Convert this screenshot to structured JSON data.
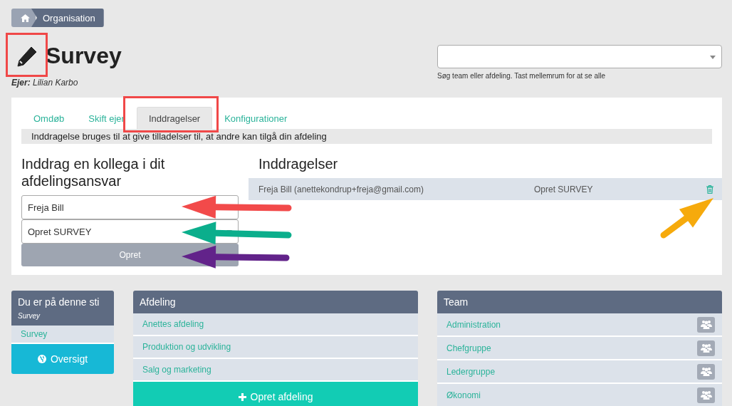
{
  "breadcrumb": [
    {
      "kind": "home"
    },
    {
      "kind": "link",
      "label": "Organisation"
    }
  ],
  "page": {
    "title": "Survey",
    "owner_label": "Ejer:",
    "owner": "Lilian Karbo"
  },
  "search": {
    "hint": "Søg team eller afdeling. Tast mellemrum for at se alle"
  },
  "tabs": [
    {
      "label": "Omdøb",
      "selected": false
    },
    {
      "label": "Skift ejer",
      "selected": false
    },
    {
      "label": "Inddragelser",
      "selected": true
    },
    {
      "label": "Konfigurationer",
      "selected": false
    }
  ],
  "info": "Inddragelse bruges til at give tilladelser til, at andre kan tilgå din afdeling",
  "form": {
    "heading": "Inddrag en kollega i dit afdelingsansvar",
    "person": "Freja Bill",
    "role": "Opret SURVEY",
    "submit": "Opret"
  },
  "involvements": {
    "heading": "Inddragelser",
    "rows": [
      {
        "person": "Freja Bill (anettekondrup+freja@gmail.com)",
        "role": "Opret SURVEY"
      }
    ]
  },
  "path_panel": {
    "title": "Du er på denne sti",
    "subtitle": "Survey",
    "items": [
      "Survey"
    ],
    "button": "Oversigt"
  },
  "departments": {
    "title": "Afdeling",
    "items": [
      "Anettes afdeling",
      "Produktion og udvikling",
      "Salg og marketing"
    ],
    "button": "Opret afdeling"
  },
  "teams": {
    "title": "Team",
    "items": [
      "Administration",
      "Chefgruppe",
      "Ledergruppe",
      "Økonomi"
    ]
  },
  "annotations": [
    {
      "kind": "box",
      "color": "#f04848"
    },
    {
      "kind": "box",
      "color": "#f04848"
    },
    {
      "kind": "arrow",
      "color": "#f24a4a"
    },
    {
      "kind": "arrow",
      "color": "#0bae8c"
    },
    {
      "kind": "arrow",
      "color": "#62238a"
    },
    {
      "kind": "arrow",
      "color": "#f6aa0c"
    }
  ]
}
